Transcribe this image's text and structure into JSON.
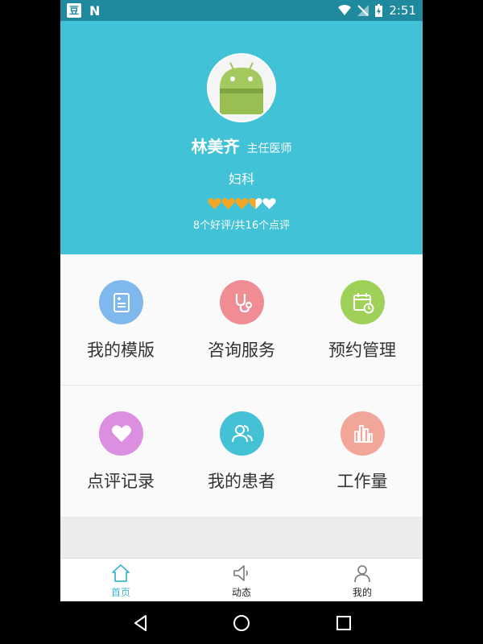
{
  "status_bar": {
    "app_icon_1": "豆",
    "app_icon_2": "N",
    "time": "2:51"
  },
  "profile": {
    "name": "林美齐",
    "title": "主任医师",
    "department": "妇科",
    "rating_stars": 3.5,
    "rating_max": 5,
    "review_summary": "8个好评/共16个点评"
  },
  "menu": [
    {
      "label": "我的模版",
      "icon": "template-icon",
      "color": "#7fb8ec"
    },
    {
      "label": "咨询服务",
      "icon": "stethoscope-icon",
      "color": "#f08c94"
    },
    {
      "label": "预约管理",
      "icon": "calendar-icon",
      "color": "#9fd158"
    },
    {
      "label": "点评记录",
      "icon": "heart-icon",
      "color": "#dc8fe0"
    },
    {
      "label": "我的患者",
      "icon": "patients-icon",
      "color": "#44c1d4"
    },
    {
      "label": "工作量",
      "icon": "bar-chart-icon",
      "color": "#f2a69a"
    }
  ],
  "tabs": [
    {
      "label": "首页",
      "icon": "home-icon",
      "active": true
    },
    {
      "label": "动态",
      "icon": "speaker-icon",
      "active": false
    },
    {
      "label": "我的",
      "icon": "user-icon",
      "active": false
    }
  ],
  "colors": {
    "header": "#41c2d6",
    "status_bar": "#1f8a9e",
    "star": "#f5a623",
    "active_tab": "#3bb8cc"
  }
}
